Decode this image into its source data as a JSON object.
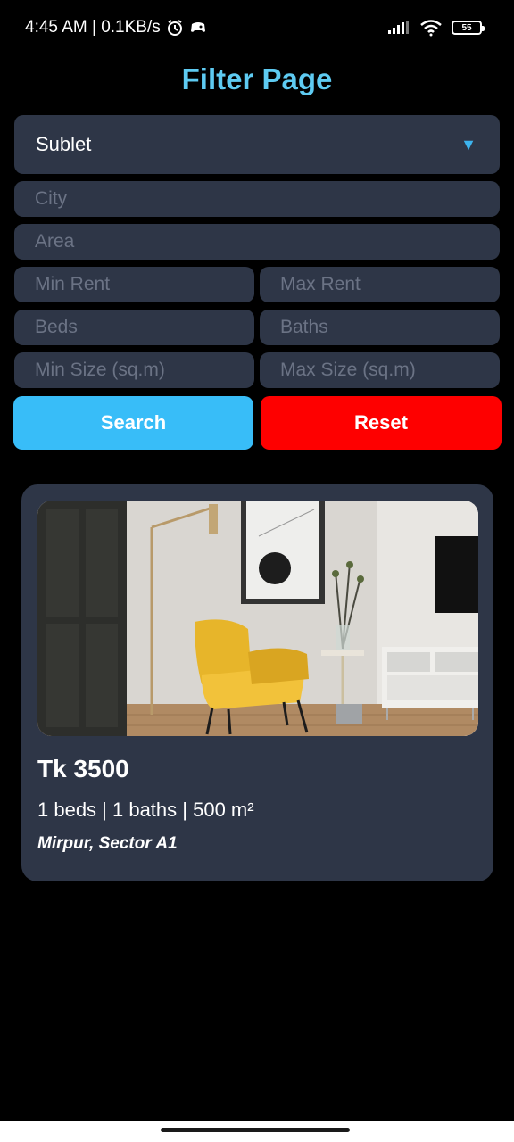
{
  "status_bar": {
    "time_and_speed": "4:45 AM | 0.1KB/s",
    "battery": "55"
  },
  "title": "Filter Page",
  "filters": {
    "type_selected": "Sublet",
    "city_placeholder": "City",
    "area_placeholder": "Area",
    "min_rent_placeholder": "Min Rent",
    "max_rent_placeholder": "Max Rent",
    "beds_placeholder": "Beds",
    "baths_placeholder": "Baths",
    "min_size_placeholder": "Min Size (sq.m)",
    "max_size_placeholder": "Max Size (sq.m)"
  },
  "buttons": {
    "search": "Search",
    "reset": "Reset"
  },
  "listing": {
    "price": "Tk 3500",
    "details": "1 beds | 1 baths | 500 m²",
    "location": "Mirpur, Sector A1"
  },
  "colors": {
    "accent": "#38bdf8",
    "reset": "#fe0000",
    "card_bg": "#2e3647",
    "title": "#5ecbf2"
  }
}
